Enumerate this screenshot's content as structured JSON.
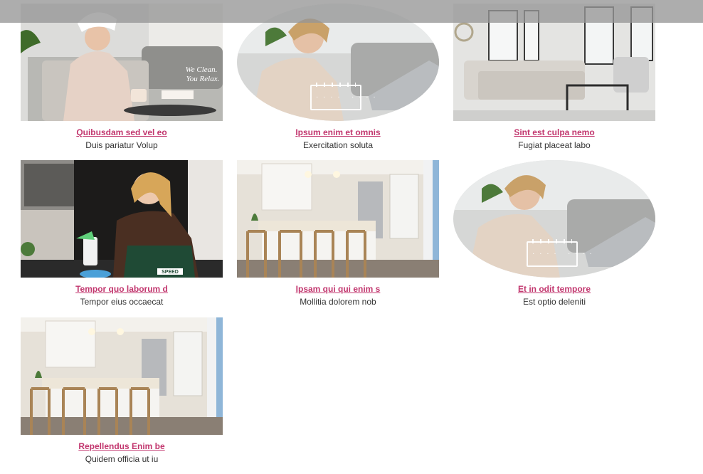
{
  "gallery": {
    "items": [
      {
        "title": "Quibusdam sed vel eo",
        "subtitle": "Duis pariatur Volup",
        "image": "woman-relaxing-towel-photo",
        "watermark_line1": "We Clean.",
        "watermark_line2": "You Relax."
      },
      {
        "title": "Ipsum enim et omnis",
        "subtitle": "Exercitation soluta",
        "image": "woman-laptop-calendar-photo"
      },
      {
        "title": "Sint est culpa nemo",
        "subtitle": "Fugiat placeat labo",
        "image": "living-room-photo"
      },
      {
        "title": "Tempor quo laborum d",
        "subtitle": "Tempor eius occaecat",
        "image": "cleaner-spray-photo",
        "apron_text": "SPEED"
      },
      {
        "title": "Ipsam qui qui enim s",
        "subtitle": "Mollitia dolorem nob",
        "image": "kitchen-photo"
      },
      {
        "title": "Et in odit tempore",
        "subtitle": "Est optio deleniti",
        "image": "woman-laptop-calendar-photo"
      },
      {
        "title": "Repellendus Enim be",
        "subtitle": "Quidem officia ut iu",
        "image": "kitchen-photo"
      }
    ]
  },
  "colors": {
    "link": "#c2366e",
    "text": "#333333",
    "overlay_bar": "#969696"
  }
}
